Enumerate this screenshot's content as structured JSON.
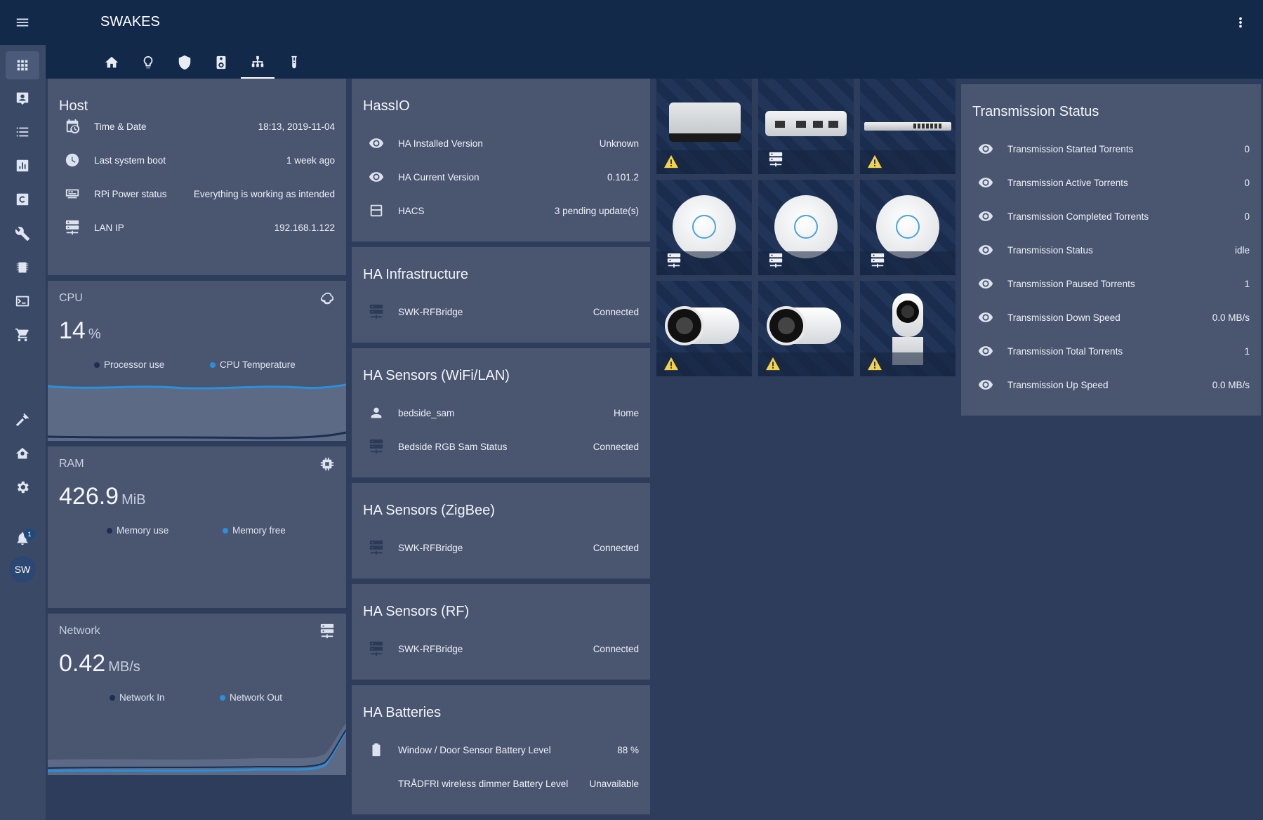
{
  "app": {
    "title": "SWAKES"
  },
  "sidebar": {
    "items": [
      {
        "icon": "menu-icon"
      },
      {
        "icon": "view-dashboard-icon"
      },
      {
        "icon": "account-box-icon"
      },
      {
        "icon": "format-list-icon"
      },
      {
        "icon": "chart-box-icon"
      },
      {
        "icon": "c-box-icon"
      },
      {
        "icon": "wrench-icon"
      },
      {
        "icon": "chip-icon"
      },
      {
        "icon": "console-icon"
      },
      {
        "icon": "cart-icon"
      },
      {
        "icon": "hammer-icon"
      },
      {
        "icon": "home-gear-icon"
      },
      {
        "icon": "cog-icon"
      },
      {
        "icon": "bell-icon"
      }
    ],
    "notification_count": "1",
    "avatar_initials": "SW"
  },
  "tabs": [
    {
      "icon": "home-icon"
    },
    {
      "icon": "lightbulb-icon"
    },
    {
      "icon": "shield-icon"
    },
    {
      "icon": "speaker-icon"
    },
    {
      "icon": "network-icon",
      "active": true
    },
    {
      "icon": "test-tube-icon"
    }
  ],
  "host": {
    "title": "Host",
    "rows": [
      {
        "icon": "calendar-clock-icon",
        "label": "Time & Date",
        "value": "18:13, 2019-11-04"
      },
      {
        "icon": "clock-icon",
        "label": "Last system boot",
        "value": "1 week ago"
      },
      {
        "icon": "power-settings-icon",
        "label": "RPi Power status",
        "value": "Everything is working as intended"
      },
      {
        "icon": "server-network-icon",
        "label": "LAN IP",
        "value": "192.168.1.122"
      }
    ]
  },
  "cpu": {
    "title": "CPU",
    "icon": "brain-icon",
    "value": "14",
    "unit": "%",
    "legend": [
      {
        "label": "Processor use",
        "color": "#1a2f52"
      },
      {
        "label": "CPU Temperature",
        "color": "#2b8fd9"
      }
    ]
  },
  "ram": {
    "title": "RAM",
    "icon": "memory-icon",
    "value": "426.9",
    "unit": "MiB",
    "legend": [
      {
        "label": "Memory use",
        "color": "#1a2f52"
      },
      {
        "label": "Memory free",
        "color": "#2b8fd9"
      }
    ]
  },
  "network": {
    "title": "Network",
    "icon": "server-network-icon",
    "value": "0.42",
    "unit": "MB/s",
    "legend": [
      {
        "label": "Network In",
        "color": "#1a2f52"
      },
      {
        "label": "Network Out",
        "color": "#2b8fd9"
      }
    ]
  },
  "hassio": {
    "title": "HassIO",
    "rows": [
      {
        "icon": "eye-icon",
        "label": "HA Installed Version",
        "value": "Unknown"
      },
      {
        "icon": "eye-icon",
        "label": "HA Current Version",
        "value": "0.101.2"
      },
      {
        "icon": "package-icon",
        "label": "HACS",
        "value": "3 pending update(s)"
      }
    ]
  },
  "ha_infrastructure": {
    "title": "HA Infrastructure",
    "rows": [
      {
        "icon": "server-network-icon",
        "label": "SWK-RFBridge",
        "value": "Connected"
      }
    ]
  },
  "ha_sensors_wifi": {
    "title": "HA Sensors (WiFi/LAN)",
    "rows": [
      {
        "icon": "account-icon",
        "label": "bedside_sam",
        "value": "Home"
      },
      {
        "icon": "server-network-icon",
        "label": "Bedside RGB Sam Status",
        "value": "Connected"
      }
    ]
  },
  "ha_sensors_zigbee": {
    "title": "HA Sensors (ZigBee)",
    "rows": [
      {
        "icon": "server-network-icon",
        "label": "SWK-RFBridge",
        "value": "Connected"
      }
    ]
  },
  "ha_sensors_rf": {
    "title": "HA Sensors (RF)",
    "rows": [
      {
        "icon": "server-network-icon",
        "label": "SWK-RFBridge",
        "value": "Connected"
      }
    ]
  },
  "ha_batteries": {
    "title": "HA Batteries",
    "rows": [
      {
        "icon": "battery-icon",
        "label": "Window / Door Sensor Battery Level",
        "value": "88 %"
      },
      {
        "icon": "",
        "label": "TRÅDFRI wireless dimmer Battery Level",
        "value": "Unavailable"
      }
    ]
  },
  "devices": [
    {
      "name": "device-gateway-image",
      "status_icon": "alert-icon"
    },
    {
      "name": "device-switch-image",
      "status_icon": "server-network-icon"
    },
    {
      "name": "device-rack-switch-image",
      "status_icon": "alert-icon"
    },
    {
      "name": "device-access-point-1-image",
      "status_icon": "server-network-icon"
    },
    {
      "name": "device-access-point-2-image",
      "status_icon": "server-network-icon"
    },
    {
      "name": "device-access-point-3-image",
      "status_icon": "server-network-icon"
    },
    {
      "name": "device-bullet-camera-1-image",
      "status_icon": "alert-icon"
    },
    {
      "name": "device-bullet-camera-2-image",
      "status_icon": "alert-icon"
    },
    {
      "name": "device-flex-camera-image",
      "status_icon": "alert-icon"
    }
  ],
  "transmission": {
    "title": "Transmission Status",
    "rows": [
      {
        "icon": "eye-icon",
        "label": "Transmission Started Torrents",
        "value": "0"
      },
      {
        "icon": "eye-icon",
        "label": "Transmission Active Torrents",
        "value": "0"
      },
      {
        "icon": "eye-icon",
        "label": "Transmission Completed Torrents",
        "value": "0"
      },
      {
        "icon": "eye-icon",
        "label": "Transmission Status",
        "value": "idle"
      },
      {
        "icon": "eye-icon",
        "label": "Transmission Paused Torrents",
        "value": "1"
      },
      {
        "icon": "eye-icon",
        "label": "Transmission Down Speed",
        "value": "0.0 MB/s"
      },
      {
        "icon": "eye-icon",
        "label": "Transmission Total Torrents",
        "value": "1"
      },
      {
        "icon": "eye-icon",
        "label": "Transmission Up Speed",
        "value": "0.0 MB/s"
      }
    ]
  }
}
